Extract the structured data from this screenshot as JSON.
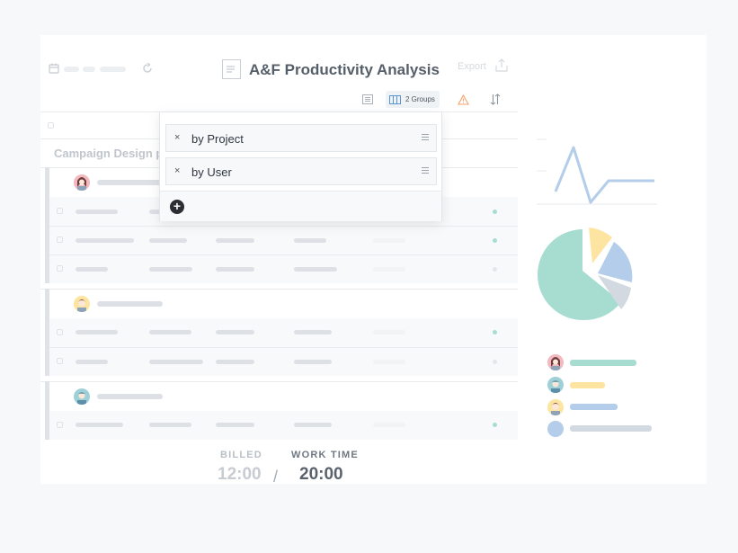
{
  "header": {
    "title": "A&F Productivity Analysis",
    "export_label": "Export",
    "groups_label": "2 Groups"
  },
  "section": {
    "title": "Campaign Design p"
  },
  "group_popup": {
    "items": [
      {
        "remove": "×",
        "label": "by Project"
      },
      {
        "remove": "×",
        "label": "by User"
      }
    ],
    "add": "+"
  },
  "totals": {
    "billed_label": "BILLED",
    "billed_value": "12:00",
    "separator": "/",
    "work_label": "WORK TIME",
    "work_value": "20:00"
  },
  "colors": {
    "teal": "#a7ddd0",
    "yellow": "#fde4a0",
    "blue": "#b3cdea",
    "gray": "#d3d9e0",
    "warning": "#f5a26b"
  },
  "icons": [
    "calendar-icon",
    "refresh-icon",
    "document-icon",
    "export-icon",
    "list-icon",
    "columns-icon",
    "warning-icon",
    "sort-icon",
    "close-icon",
    "drag-handle-icon",
    "plus-icon"
  ]
}
